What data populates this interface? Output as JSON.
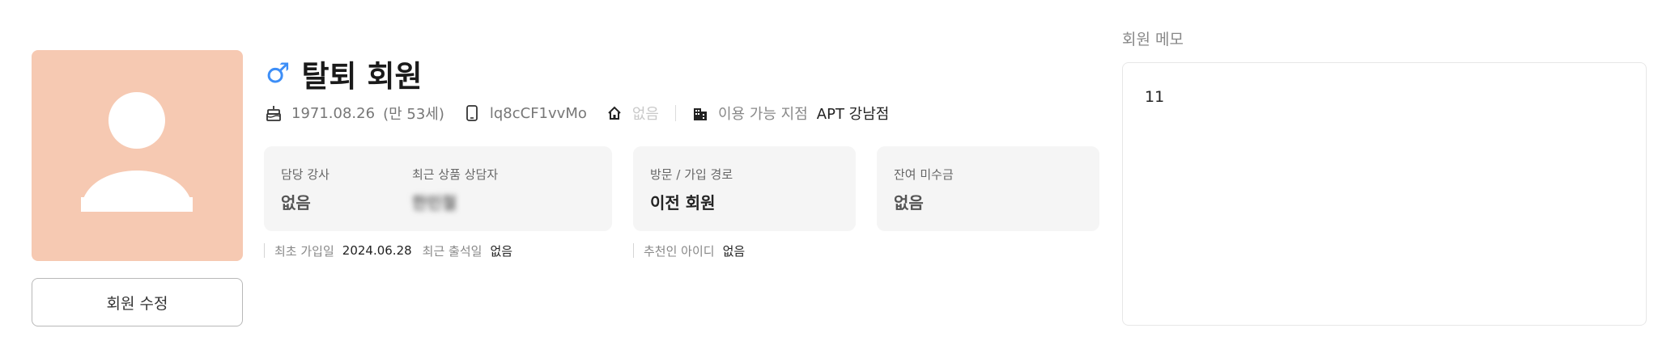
{
  "profile": {
    "edit_button": "회원 수정"
  },
  "member": {
    "gender_symbol": "♂",
    "name": "탈퇴 회원",
    "birthdate": "1971.08.26",
    "age": "(만 53세)",
    "phone": "lq8cCF1vvMo",
    "address": "없음",
    "branch_label": "이용 가능 지점",
    "branch_value": "APT 강남점"
  },
  "cards": {
    "instructor_label": "담당 강사",
    "instructor_value": "없음",
    "consultant_label": "최근 상품 상담자",
    "consultant_value": "한민철",
    "route_label": "방문 / 가입 경로",
    "route_value": "이전 회원",
    "balance_label": "잔여 미수금",
    "balance_value": "없음"
  },
  "dates": {
    "first_join_label": "최초 가입일",
    "first_join_value": "2024.06.28",
    "last_attend_label": "최근 출석일",
    "last_attend_value": "없음",
    "referrer_label": "추천인 아이디",
    "referrer_value": "없음"
  },
  "memo": {
    "title": "회원 메모",
    "content": "11"
  },
  "colors": {
    "avatar_bg": "#f6c9b2",
    "gender_icon": "#3d8ef7",
    "card_bg": "#f5f5f5"
  },
  "icons": [
    "avatar-silhouette-icon",
    "male-icon",
    "birthday-cake-icon",
    "phone-icon",
    "home-icon",
    "building-icon"
  ]
}
